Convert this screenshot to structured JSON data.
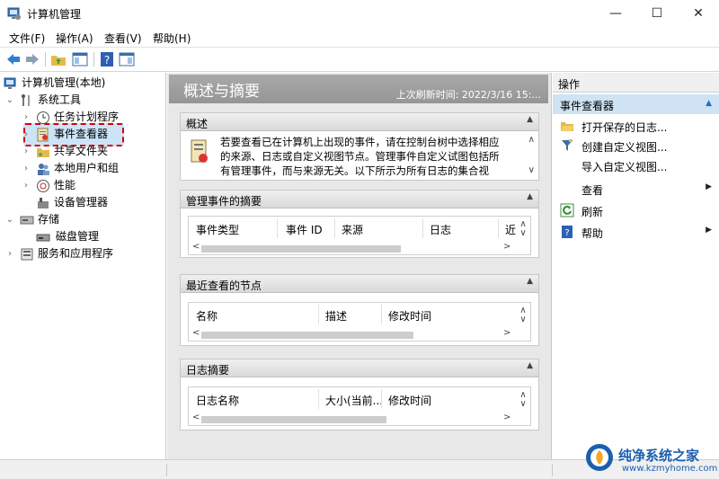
{
  "window": {
    "title": "计算机管理",
    "minimize": "—",
    "maximize": "☐",
    "close": "✕"
  },
  "menu": [
    "文件(F)",
    "操作(A)",
    "查看(V)",
    "帮助(H)"
  ],
  "tree": {
    "root": "计算机管理(本地)",
    "system_tools": "系统工具",
    "task_scheduler": "任务计划程序",
    "event_viewer": "事件查看器",
    "shared_folders": "共享文件夹",
    "local_users": "本地用户和组",
    "performance": "性能",
    "device_manager": "设备管理器",
    "storage": "存储",
    "disk_mgmt": "磁盘管理",
    "services_apps": "服务和应用程序"
  },
  "middle": {
    "title": "概述与摘要",
    "refresh": "上次刷新时间: 2022/3/16 15:...",
    "overview": {
      "title": "概述",
      "text": "若要查看已在计算机上出现的事件，请在控制台树中选择相应的来源、日志或自定义视图节点。管理事件自定义试图包括所有管理事件，而与来源无关。以下所示为所有日志的集合视"
    },
    "managed_events": {
      "title": "管理事件的摘要",
      "cols": [
        "事件类型",
        "事件 ID",
        "来源",
        "日志",
        "近"
      ]
    },
    "recent_nodes": {
      "title": "最近查看的节点",
      "cols": [
        "名称",
        "描述",
        "修改时间"
      ]
    },
    "log_summary": {
      "title": "日志摘要",
      "cols": [
        "日志名称",
        "大小(当前...",
        "修改时间"
      ]
    }
  },
  "actions": {
    "title": "操作",
    "group": "事件查看器",
    "items": [
      "打开保存的日志...",
      "创建自定义视图...",
      "导入自定义视图...",
      "查看",
      "刷新",
      "帮助"
    ]
  },
  "watermark": {
    "name": "纯净系统之家",
    "url": "www.kzmyhome.com"
  }
}
